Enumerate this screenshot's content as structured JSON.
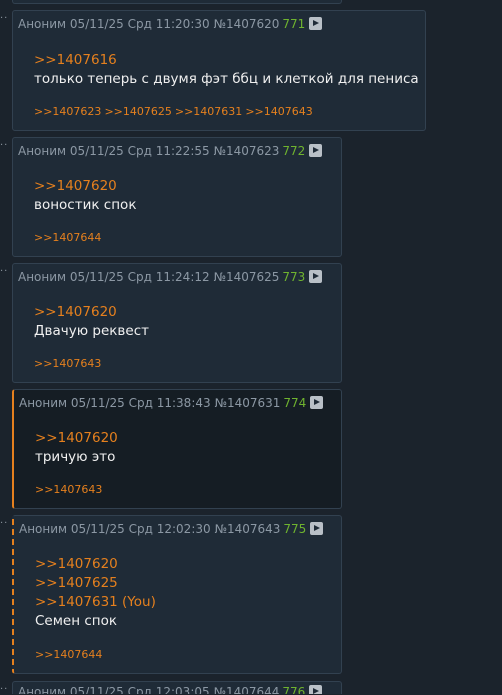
{
  "posts": [
    {
      "name": "Аноним",
      "datetime": "05/11/25 Срд 11:20:30",
      "id": "№1407620",
      "count": "771",
      "replies": [
        ">>1407616"
      ],
      "text": "только теперь с двумя фэт ббц и клеткой для пениса",
      "backlinks": [
        ">>1407623",
        ">>1407625",
        ">>1407631",
        ">>1407643"
      ]
    },
    {
      "name": "Аноним",
      "datetime": "05/11/25 Срд 11:22:55",
      "id": "№1407623",
      "count": "772",
      "replies": [
        ">>1407620"
      ],
      "text": "воностик спок",
      "backlinks": [
        ">>1407644"
      ]
    },
    {
      "name": "Аноним",
      "datetime": "05/11/25 Срд 11:24:12",
      "id": "№1407625",
      "count": "773",
      "replies": [
        ">>1407620"
      ],
      "text": "Двачую реквест",
      "backlinks": [
        ">>1407643"
      ]
    },
    {
      "name": "Аноним",
      "datetime": "05/11/25 Срд 11:38:43",
      "id": "№1407631",
      "count": "774",
      "replies": [
        ">>1407620"
      ],
      "text": "тричую это",
      "backlinks": [
        ">>1407643"
      ]
    },
    {
      "name": "Аноним",
      "datetime": "05/11/25 Срд 12:02:30",
      "id": "№1407643",
      "count": "775",
      "replies": [
        ">>1407620",
        ">>1407625",
        ">>1407631 (You)"
      ],
      "text": "Семен спок",
      "backlinks": [
        ">>1407644"
      ]
    },
    {
      "name": "Аноним",
      "datetime": "05/11/25 Срд 12:03:05",
      "id": "№1407644",
      "count": "776"
    }
  ]
}
